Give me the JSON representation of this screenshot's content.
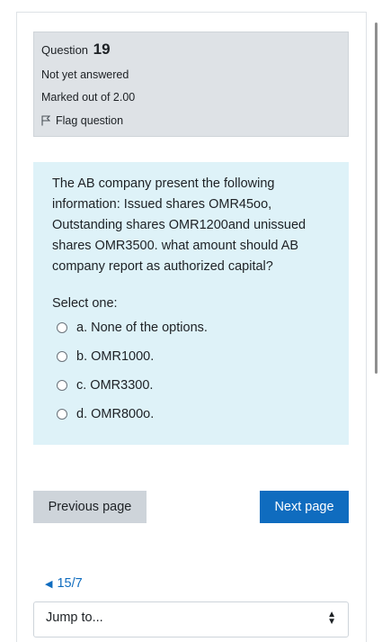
{
  "info": {
    "question_label": "Question",
    "question_number": "19",
    "status": "Not yet answered",
    "marks": "Marked out of 2.00",
    "flag_label": "Flag question"
  },
  "question": {
    "text": "The AB company present the following information: Issued shares OMR45oo, Outstanding shares OMR1200and unissued shares OMR3500. what amount should AB company report as authorized capital?",
    "prompt": "Select one:",
    "options": [
      "a. None of the options.",
      "b. OMR1000.",
      "c. OMR3300.",
      "d. OMR800o."
    ]
  },
  "nav": {
    "previous": "Previous page",
    "next": "Next page",
    "back_link": "15/7",
    "jump_label": "Jump to..."
  },
  "colors": {
    "info_bg": "#dee2e6",
    "content_bg": "#def2f8",
    "primary": "#0f6cbf",
    "secondary": "#ced4da"
  }
}
